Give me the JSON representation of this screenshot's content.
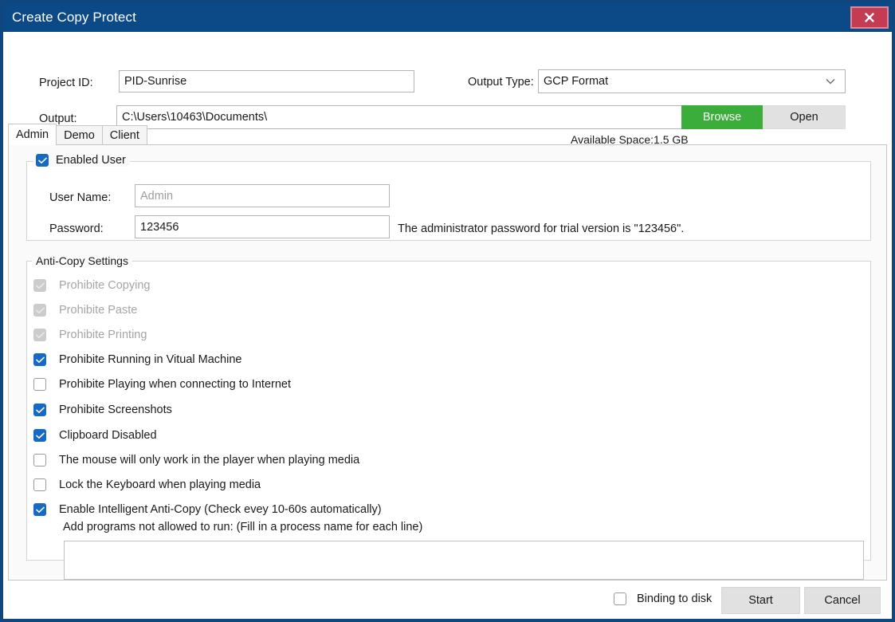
{
  "window": {
    "title": "Create Copy Protect",
    "close_icon": "close-icon"
  },
  "form": {
    "project_id_label": "Project ID:",
    "project_id_value": "PID-Sunrise",
    "output_type_label": "Output Type:",
    "output_type_value": "GCP Format",
    "output_type_options": [
      "GCP Format"
    ],
    "output_label": "Output:",
    "output_value": "C:\\Users\\10463\\Documents\\",
    "browse_label": "Browse",
    "open_label": "Open",
    "available_space": "Available Space:1.5 GB"
  },
  "tabs": [
    {
      "label": "Admin",
      "active": true
    },
    {
      "label": "Demo",
      "active": false
    },
    {
      "label": "Client",
      "active": false
    }
  ],
  "enabled_user": {
    "legend": "Enabled User",
    "legend_checked": true,
    "username_label": "User Name:",
    "username_placeholder": "Admin",
    "username_value": "",
    "password_label": "Password:",
    "password_value": "123456",
    "password_hint": "The administrator password for trial version is \"123456\"."
  },
  "anti_copy": {
    "legend": "Anti-Copy Settings",
    "items": [
      {
        "label": "Prohibite Copying",
        "checked": true,
        "disabled": true
      },
      {
        "label": "Prohibite Paste",
        "checked": true,
        "disabled": true
      },
      {
        "label": "Prohibite Printing",
        "checked": true,
        "disabled": true
      },
      {
        "label": "Prohibite Running in Vitual Machine",
        "checked": true,
        "disabled": false
      },
      {
        "label": "Prohibite Playing when connecting to Internet",
        "checked": false,
        "disabled": false
      },
      {
        "label": "Prohibite Screenshots",
        "checked": true,
        "disabled": false
      },
      {
        "label": "Clipboard Disabled",
        "checked": true,
        "disabled": false
      },
      {
        "label": "The mouse will only work in the player when playing media",
        "checked": false,
        "disabled": false
      },
      {
        "label": "Lock the Keyboard when playing media",
        "checked": false,
        "disabled": false
      },
      {
        "label": "Enable Intelligent Anti-Copy (Check evey 10-60s automatically)",
        "checked": true,
        "disabled": false
      }
    ],
    "process_hint": "Add programs not allowed to run: (Fill in a process name for each line)",
    "process_value": ""
  },
  "footer": {
    "binding_label": "Binding to disk",
    "binding_checked": false,
    "start_label": "Start",
    "cancel_label": "Cancel"
  },
  "colors": {
    "titlebar": "#0b4a87",
    "close": "#c43c54",
    "accent_checkbox": "#1669c5",
    "browse_green": "#3aad3a",
    "button_gray": "#e1e1e1"
  }
}
